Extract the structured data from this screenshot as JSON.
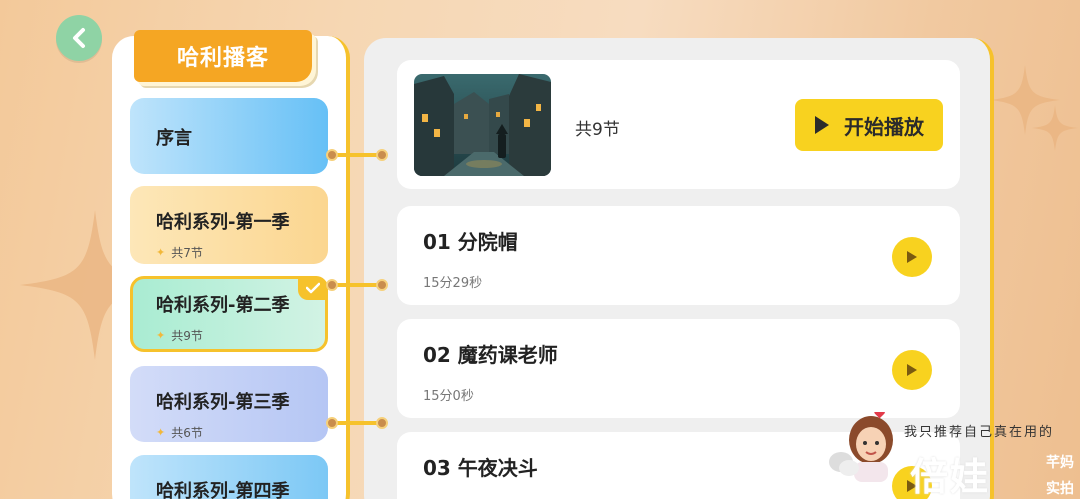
{
  "app": {
    "section_title": "哈利播客"
  },
  "seasons": [
    {
      "name": "序言",
      "count": ""
    },
    {
      "name": "哈利系列-第一季",
      "count": "共7节"
    },
    {
      "name": "哈利系列-第二季",
      "count": "共9节"
    },
    {
      "name": "哈利系列-第三季",
      "count": "共6节"
    },
    {
      "name": "哈利系列-第四季",
      "count": ""
    }
  ],
  "header": {
    "count_label": "共9节",
    "start_label": "开始播放"
  },
  "episodes": [
    {
      "title": "01 分院帽",
      "duration": "15分29秒"
    },
    {
      "title": "02 魔药课老师",
      "duration": "15分0秒"
    },
    {
      "title": "03 午夜决斗",
      "duration": ""
    }
  ],
  "watermark": {
    "tagline": "我只推荐自己真在用的",
    "brand": "倍娃",
    "side1": "芊妈",
    "side2": "实拍"
  },
  "colors": {
    "accent_yellow": "#f8d21f",
    "title_orange": "#f5a623",
    "back_green": "#8fd3a5"
  },
  "icons": {
    "back": "chevron-left-icon",
    "play": "play-triangle-icon",
    "check": "check-icon",
    "star": "star-icon"
  }
}
